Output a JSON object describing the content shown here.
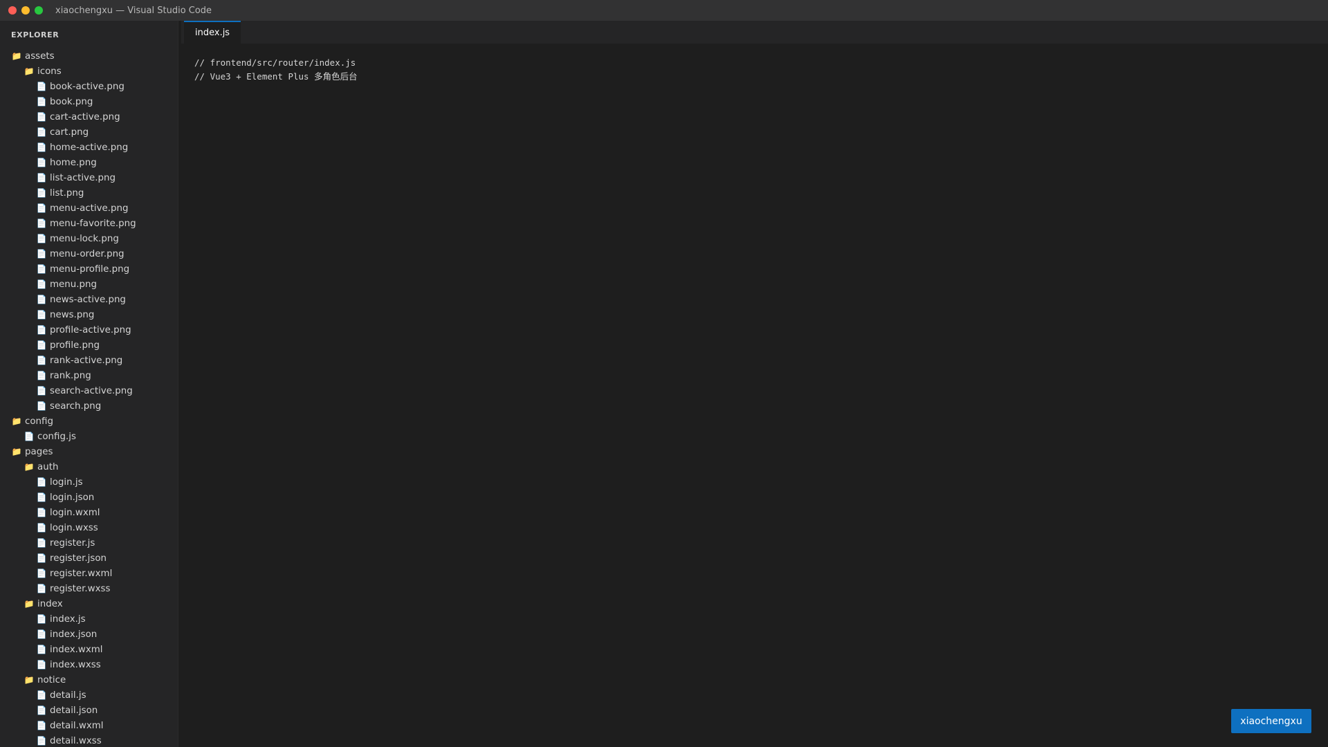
{
  "window": {
    "title": "xiaochengxu — Visual Studio Code"
  },
  "sidebar": {
    "header": "EXPLORER",
    "items": [
      {
        "label": "assets",
        "type": "folder",
        "depth": 0
      },
      {
        "label": "icons",
        "type": "folder",
        "depth": 1
      },
      {
        "label": "book-active.png",
        "type": "file",
        "depth": 2
      },
      {
        "label": "book.png",
        "type": "file",
        "depth": 2
      },
      {
        "label": "cart-active.png",
        "type": "file",
        "depth": 2
      },
      {
        "label": "cart.png",
        "type": "file",
        "depth": 2
      },
      {
        "label": "home-active.png",
        "type": "file",
        "depth": 2
      },
      {
        "label": "home.png",
        "type": "file",
        "depth": 2
      },
      {
        "label": "list-active.png",
        "type": "file",
        "depth": 2
      },
      {
        "label": "list.png",
        "type": "file",
        "depth": 2
      },
      {
        "label": "menu-active.png",
        "type": "file",
        "depth": 2
      },
      {
        "label": "menu-favorite.png",
        "type": "file",
        "depth": 2
      },
      {
        "label": "menu-lock.png",
        "type": "file",
        "depth": 2
      },
      {
        "label": "menu-order.png",
        "type": "file",
        "depth": 2
      },
      {
        "label": "menu-profile.png",
        "type": "file",
        "depth": 2
      },
      {
        "label": "menu.png",
        "type": "file",
        "depth": 2
      },
      {
        "label": "news-active.png",
        "type": "file",
        "depth": 2
      },
      {
        "label": "news.png",
        "type": "file",
        "depth": 2
      },
      {
        "label": "profile-active.png",
        "type": "file",
        "depth": 2
      },
      {
        "label": "profile.png",
        "type": "file",
        "depth": 2
      },
      {
        "label": "rank-active.png",
        "type": "file",
        "depth": 2
      },
      {
        "label": "rank.png",
        "type": "file",
        "depth": 2
      },
      {
        "label": "search-active.png",
        "type": "file",
        "depth": 2
      },
      {
        "label": "search.png",
        "type": "file",
        "depth": 2
      },
      {
        "label": "config",
        "type": "folder",
        "depth": 0
      },
      {
        "label": "config.js",
        "type": "file",
        "depth": 1
      },
      {
        "label": "pages",
        "type": "folder",
        "depth": 0
      },
      {
        "label": "auth",
        "type": "folder",
        "depth": 1
      },
      {
        "label": "login.js",
        "type": "file",
        "depth": 2
      },
      {
        "label": "login.json",
        "type": "file",
        "depth": 2
      },
      {
        "label": "login.wxml",
        "type": "file",
        "depth": 2
      },
      {
        "label": "login.wxss",
        "type": "file",
        "depth": 2
      },
      {
        "label": "register.js",
        "type": "file",
        "depth": 2
      },
      {
        "label": "register.json",
        "type": "file",
        "depth": 2
      },
      {
        "label": "register.wxml",
        "type": "file",
        "depth": 2
      },
      {
        "label": "register.wxss",
        "type": "file",
        "depth": 2
      },
      {
        "label": "index",
        "type": "folder",
        "depth": 1
      },
      {
        "label": "index.js",
        "type": "file",
        "depth": 2
      },
      {
        "label": "index.json",
        "type": "file",
        "depth": 2
      },
      {
        "label": "index.wxml",
        "type": "file",
        "depth": 2
      },
      {
        "label": "index.wxss",
        "type": "file",
        "depth": 2
      },
      {
        "label": "notice",
        "type": "folder",
        "depth": 1
      },
      {
        "label": "detail.js",
        "type": "file",
        "depth": 2
      },
      {
        "label": "detail.json",
        "type": "file",
        "depth": 2
      },
      {
        "label": "detail.wxml",
        "type": "file",
        "depth": 2
      },
      {
        "label": "detail.wxss",
        "type": "file",
        "depth": 2
      }
    ]
  },
  "editor": {
    "active_tab": "index.js",
    "lines": [
      "// frontend/src/router/index.js",
      "// Vue3 + Element Plus 多角色后台"
    ]
  },
  "status": {
    "user_badge": "xiaochengxu"
  },
  "colors": {
    "accent": "#0e70c0",
    "folder": "#e8b64a"
  }
}
